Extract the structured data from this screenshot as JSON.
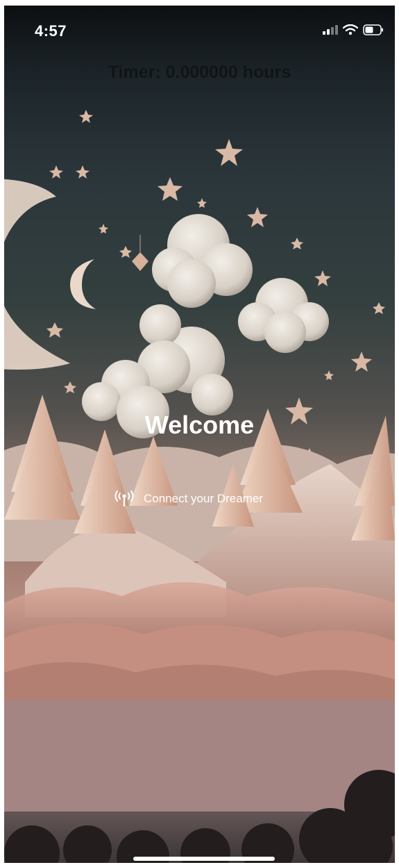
{
  "status_bar": {
    "time": "4:57",
    "icons": [
      "cellular-signal-icon",
      "wifi-icon",
      "battery-icon"
    ]
  },
  "timer": {
    "text": "Timer: 0.000000 hours"
  },
  "welcome": {
    "title": "Welcome"
  },
  "connect": {
    "icon": "antenna-broadcast-icon",
    "label": "Connect your Dreamer"
  },
  "colors": {
    "text_primary": "#ffffff",
    "timer_text": "#0f1214",
    "sky_top": "#0d0f12",
    "sky_mid": "#2b363b",
    "paper_pink": "#b9958a"
  }
}
